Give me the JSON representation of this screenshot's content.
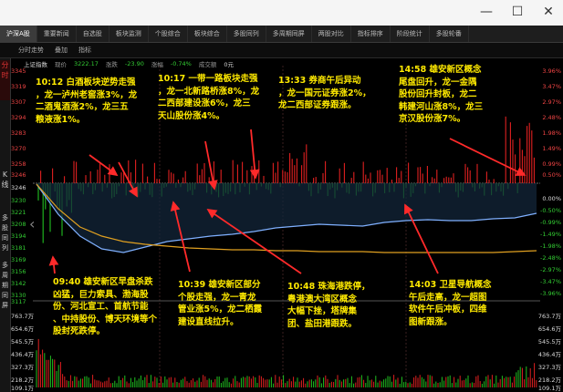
{
  "window": {
    "minimize_icon": "—",
    "maximize_icon": "☐",
    "close_icon": "✕"
  },
  "tabs": [
    "沪深A股",
    "重要新闻",
    "自选股",
    "板块监测",
    "个股综合",
    "板块综合",
    "多股同列",
    "多周期同屏",
    "两股对比",
    "指标排序",
    "阶段统计",
    "多股轮番"
  ],
  "toolbar": {
    "analysis": "分时走势",
    "overlay": "叠加",
    "indicator": "指标"
  },
  "info": {
    "index": "上证指数",
    "price_label": "现价",
    "price_value": "3222.17",
    "change_label": "涨跌",
    "change_value": "-23.90",
    "pct_label": "涨幅",
    "pct_value": "-0.74%",
    "volume_label": "成交额",
    "volume_value": "0元"
  },
  "left_tabs": {
    "tab1": "分时",
    "tab2": "K线",
    "tab3": "多股同列",
    "tab4": "多周期同屏"
  },
  "price_axis": {
    "upper": [
      "3345",
      "3319",
      "3307",
      "3294",
      "3283",
      "3270",
      "3258",
      "3246"
    ],
    "mid": "3246",
    "lower": [
      "3230",
      "3221",
      "3208",
      "3194",
      "3181",
      "3169",
      "3156",
      "3142",
      "3130",
      "3117"
    ],
    "volume": [
      "763.7万",
      "654.6万",
      "545.5万",
      "436.4万",
      "327.3万",
      "218.2万",
      "109.1万"
    ]
  },
  "pct_axis": {
    "upper": [
      "3.96%",
      "3.47%",
      "2.97%",
      "2.48%",
      "1.98%",
      "1.49%",
      "0.99%",
      "0.50%"
    ],
    "mid": "0.00%",
    "lower": [
      "-0.50%",
      "-0.99%",
      "-1.49%",
      "-1.98%",
      "-2.48%",
      "-2.97%",
      "-3.47%",
      "-3.96%"
    ],
    "volume": [
      "763.7万",
      "654.6万",
      "545.5万",
      "436.4万",
      "327.3万",
      "218.2万",
      "109.1万"
    ]
  },
  "annotations": [
    {
      "lines": [
        "10:12 白酒板块逆势走强",
        "，龙一泸州老窖涨3%，龙",
        "二酒鬼酒涨2%，龙三五",
        "粮液涨1%。"
      ]
    },
    {
      "lines": [
        "10:17 一带一路板块走强",
        "，龙一北新路桥涨8%，龙",
        "二西部建设涨6%，龙三",
        "天山股份涨4%。"
      ]
    },
    {
      "lines": [
        "13:33 券商午后异动",
        "，龙一国元证券涨2%，",
        "龙二西部证券跟涨。"
      ]
    },
    {
      "lines": [
        "14:58 雄安新区概念",
        "尾盘回升，龙一金隅",
        "股份回升封板，龙二",
        "韩建河山涨8%，龙三",
        "京汉股份涨7%。"
      ]
    },
    {
      "lines": [
        "09:40 雄安新区早盘杀跌",
        "凶猛，巨力索具、渤海股",
        "份、河北宣工、首航节能",
        "、中持股份、博天环境等个",
        "股封死跌停。"
      ]
    },
    {
      "lines": [
        "10:39 雄安新区部分",
        "个股走强，龙一青龙",
        "管业涨5%，龙二栖霞",
        "建设直线拉升。"
      ]
    },
    {
      "lines": [
        "10:48 珠海港跌停，",
        "粤港澳大湾区概念",
        "大幅下挫，塔牌集",
        "团、盐田港跟跌。"
      ]
    },
    {
      "lines": [
        "14:03 卫星导航概念",
        "午后走高，龙一超图",
        "软件午后冲板，四维",
        "图新跟涨。"
      ]
    }
  ],
  "colors": {
    "up": "#e02020",
    "down": "#20c020",
    "price_line": "#7fb0ff",
    "avg_line": "#e0a020",
    "annotation": "#ffea00",
    "arrow": "#ff2a2a"
  },
  "chart_data": {
    "type": "line",
    "x_range": [
      "09:30",
      "15:00"
    ],
    "series": [
      {
        "values": [
          3245,
          3212,
          3188,
          3174,
          3170,
          3176,
          3182,
          3185,
          3188,
          3190,
          3193,
          3197,
          3199,
          3201,
          3200,
          3199,
          3203,
          3205,
          3206,
          3205,
          3205,
          3207,
          3208,
          3213
        ]
      },
      {
        "values": [
          3245,
          3218,
          3198,
          3188,
          3182,
          3179,
          3177,
          3175,
          3174,
          3173,
          3173,
          3172,
          3172,
          3171,
          3171,
          3171,
          3170,
          3170,
          3170,
          3170,
          3170,
          3170,
          3171,
          3172
        ]
      }
    ],
    "ylim": [
      3117,
      3375
    ],
    "baseline": 3246
  }
}
